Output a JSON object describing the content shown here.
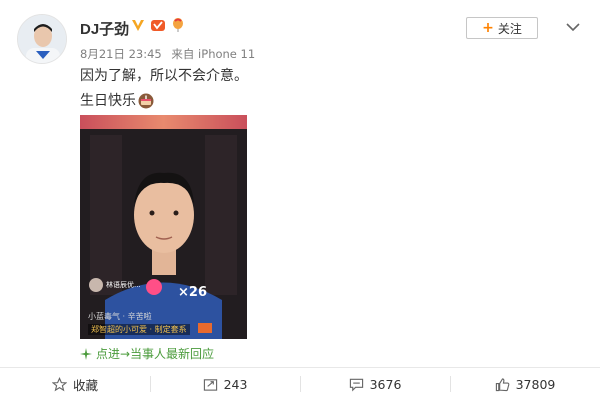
{
  "post": {
    "username": "DJ子劲",
    "meta": {
      "time": "8月21日 23:45",
      "source": "来自 iPhone 11"
    },
    "follow_label": "关注",
    "text_line1": "因为了解，所以不会介意。",
    "text_line2": "生日快乐",
    "video": {
      "count": "26",
      "streamer": "林语辰优...",
      "caption": "小蓝毒气 · 辛苦啦",
      "tag": "郑智超的小可爱 · 制定套系"
    },
    "reply_link": "点进→当事人最新回应"
  },
  "actions": {
    "favorite": "收藏",
    "repost": "243",
    "comment": "3676",
    "like": "37809"
  },
  "colors": {
    "accent": "#ff8200",
    "link_green": "#4a9b3b",
    "text": "#333333",
    "muted": "#808080"
  },
  "icons": [
    "verified-v-icon",
    "vip-badge-icon",
    "balloon-badge-icon",
    "chevron-down-icon",
    "cake-emoji-icon",
    "star-icon",
    "repost-icon",
    "comment-icon",
    "thumb-up-icon",
    "sparkle-icon"
  ]
}
